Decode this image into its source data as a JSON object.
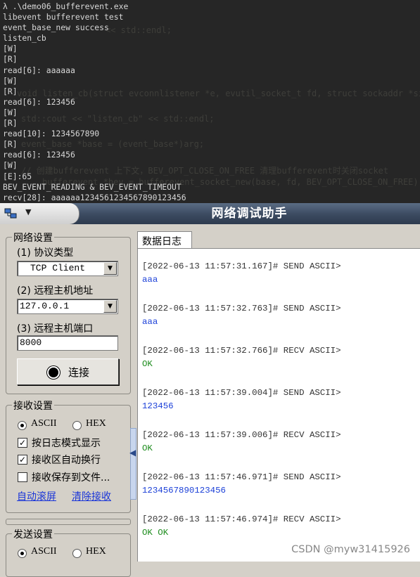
{
  "terminal": {
    "lines": [
      "λ .\\demo06_bufferevent.exe",
      "libevent bufferevent test",
      "event_base_new success",
      "listen_cb",
      "[W]",
      "[R]",
      "read[6]: aaaaaa",
      "[W]",
      "[R]",
      "read[6]: 123456",
      "[W]",
      "[R]",
      "read[10]: 1234567890",
      "[R]",
      "read[6]: 123456",
      "[W]",
      "[E]:65",
      "BEV_EVENT_READING & BEV_EVENT_TIMEOUT",
      "recv[28]: aaaaaa1234561234567890123456"
    ],
    "ghost_lines": [
      "<< std::endl;",
      "void listen_cb(struct evconnlistener *e, evutil_socket_t fd, struct sockaddr *sin, int slen, vo",
      "std::cout << \"listen_cb\" << std::endl;",
      "event_base *base = (event_base*)arg;",
      "// 创建bufferevent 上下文，BEV_OPT_CLOSE_ON_FREE 清理bufferevent时关闭socket",
      "bufferevent *bev = bufferevent_socket_new(base, fd, BEV_OPT_CLOSE_ON_FREE);"
    ]
  },
  "window": {
    "title": "网络调试助手"
  },
  "net_settings": {
    "title": "网络设置",
    "protocol_label": "(1) 协议类型",
    "protocol_value": "TCP Client",
    "host_label": "(2) 远程主机地址",
    "host_value": "127.0.0.1",
    "port_label": "(3) 远程主机端口",
    "port_value": "8000",
    "connect_label": "连接"
  },
  "recv_settings": {
    "title": "接收设置",
    "ascii_label": "ASCII",
    "hex_label": "HEX",
    "log_mode_label": "按日志模式显示",
    "auto_wrap_label": "接收区自动换行",
    "save_file_label": "接收保存到文件...",
    "auto_scroll_link": "自动滚屏",
    "clear_link": "清除接收"
  },
  "send_settings": {
    "title": "发送设置",
    "ascii_label": "ASCII",
    "hex_label": "HEX"
  },
  "log": {
    "tab_label": "数据日志",
    "entries": [
      {
        "header": "[2022-06-13 11:57:31.167]# SEND ASCII>",
        "body": "aaa",
        "kind": "send"
      },
      {
        "header": "[2022-06-13 11:57:32.763]# SEND ASCII>",
        "body": "aaa",
        "kind": "send"
      },
      {
        "header": "[2022-06-13 11:57:32.766]# RECV ASCII>",
        "body": "OK",
        "kind": "recv"
      },
      {
        "header": "[2022-06-13 11:57:39.004]# SEND ASCII>",
        "body": "123456",
        "kind": "send"
      },
      {
        "header": "[2022-06-13 11:57:39.006]# RECV ASCII>",
        "body": "OK",
        "kind": "recv"
      },
      {
        "header": "[2022-06-13 11:57:46.971]# SEND ASCII>",
        "body": "1234567890123456",
        "kind": "send"
      },
      {
        "header": "[2022-06-13 11:57:46.974]# RECV ASCII>",
        "body": "OK OK",
        "kind": "recv"
      }
    ]
  },
  "watermark": "CSDN @myw31415926",
  "colors": {
    "send_text": "#1a3fd8",
    "recv_text": "#1d8c1d",
    "terminal_bg": "#262626"
  }
}
